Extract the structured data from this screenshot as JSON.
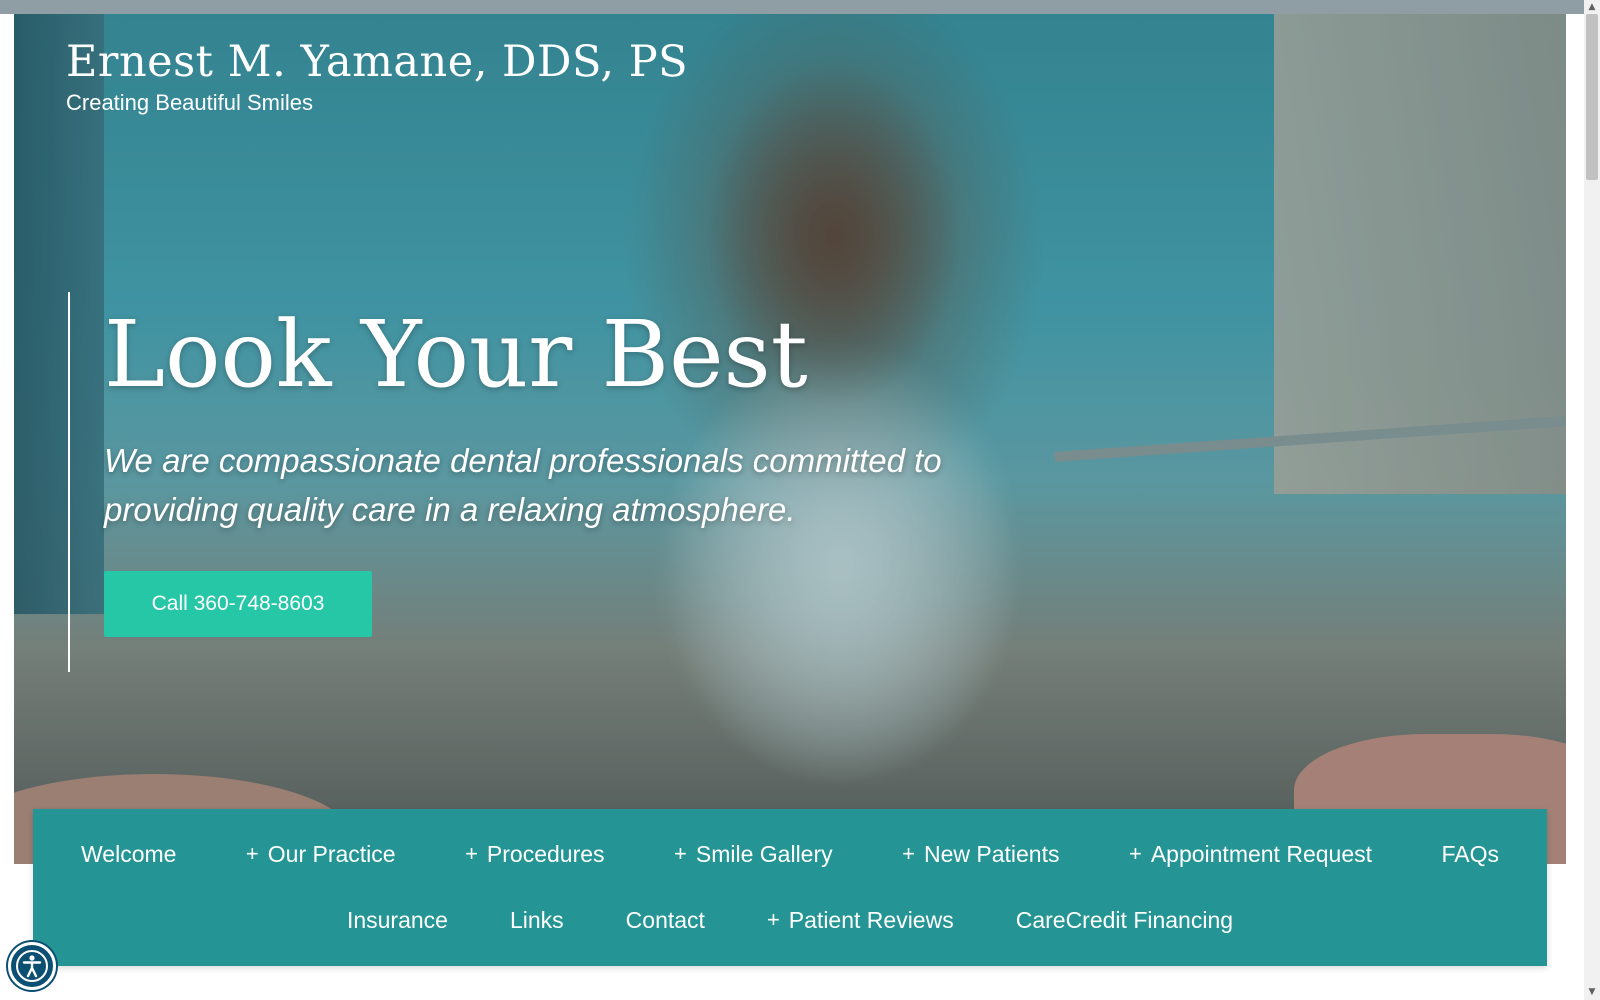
{
  "brand": {
    "title": "Ernest M. Yamane, DDS, PS",
    "tagline": "Creating Beautiful Smiles"
  },
  "hero": {
    "heading": "Look Your Best",
    "subtitle": "We are compassionate dental professionals committed to providing quality care in a relaxing atmosphere.",
    "call_button": "Call 360-748-8603"
  },
  "nav": {
    "row1": [
      {
        "label": "Welcome",
        "expandable": false
      },
      {
        "label": "Our Practice",
        "expandable": true
      },
      {
        "label": "Procedures",
        "expandable": true
      },
      {
        "label": "Smile Gallery",
        "expandable": true
      },
      {
        "label": "New Patients",
        "expandable": true
      },
      {
        "label": "Appointment Request",
        "expandable": true
      },
      {
        "label": "FAQs",
        "expandable": false
      }
    ],
    "row2": [
      {
        "label": "Insurance",
        "expandable": false
      },
      {
        "label": "Links",
        "expandable": false
      },
      {
        "label": "Contact",
        "expandable": false
      },
      {
        "label": "Patient Reviews",
        "expandable": true
      },
      {
        "label": "CareCredit Financing",
        "expandable": false
      }
    ],
    "plus_symbol": "+"
  },
  "icons": {
    "accessibility": "accessibility-icon",
    "expand": "plus-icon"
  },
  "colors": {
    "nav_background": "#249594",
    "call_button": "#25c7a6",
    "accessibility_button": "#0b4f73"
  }
}
